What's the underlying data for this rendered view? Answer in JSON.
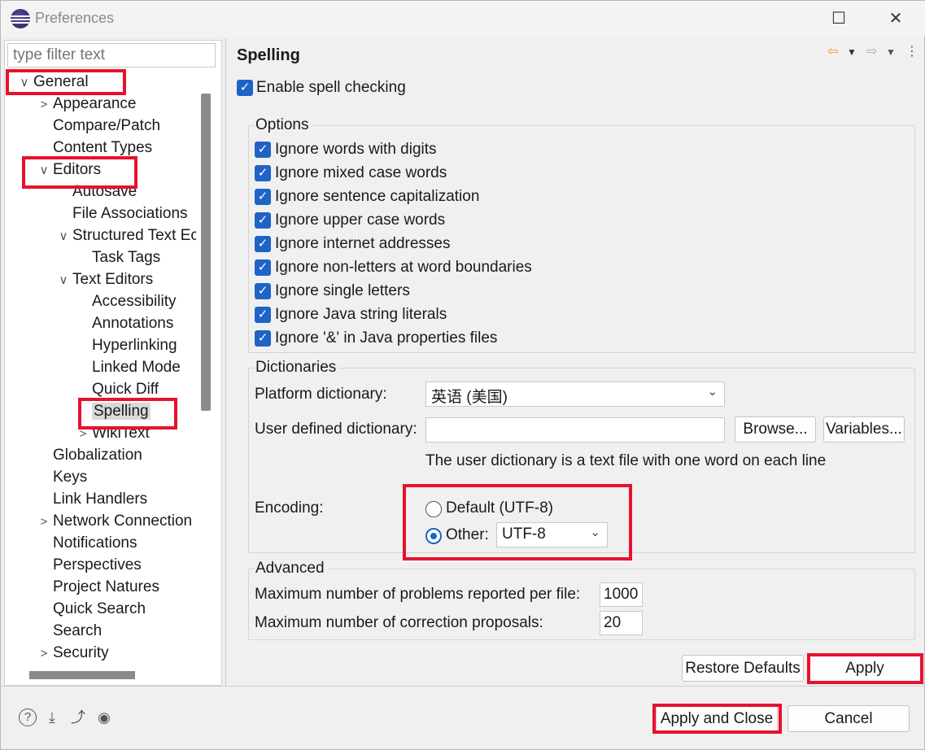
{
  "window": {
    "title": "Preferences",
    "maximize_icon": "☐",
    "close_icon": "✕"
  },
  "filter": {
    "placeholder": "type filter text"
  },
  "tree": [
    {
      "label": "General",
      "chev": "∨"
    },
    {
      "label": "Appearance",
      "chev": ">"
    },
    {
      "label": "Compare/Patch",
      "chev": ""
    },
    {
      "label": "Content Types",
      "chev": ""
    },
    {
      "label": "Editors",
      "chev": "∨"
    },
    {
      "label": "Autosave",
      "chev": ""
    },
    {
      "label": "File Associations",
      "chev": ""
    },
    {
      "label": "Structured Text Ec",
      "chev": "∨"
    },
    {
      "label": "Task Tags",
      "chev": ""
    },
    {
      "label": "Text Editors",
      "chev": "∨"
    },
    {
      "label": "Accessibility",
      "chev": ""
    },
    {
      "label": "Annotations",
      "chev": ""
    },
    {
      "label": "Hyperlinking",
      "chev": ""
    },
    {
      "label": "Linked Mode",
      "chev": ""
    },
    {
      "label": "Quick Diff",
      "chev": ""
    },
    {
      "label": "Spelling",
      "chev": ""
    },
    {
      "label": "WikiText",
      "chev": ">"
    },
    {
      "label": "Globalization",
      "chev": ""
    },
    {
      "label": "Keys",
      "chev": ""
    },
    {
      "label": "Link Handlers",
      "chev": ""
    },
    {
      "label": "Network Connection",
      "chev": ">"
    },
    {
      "label": "Notifications",
      "chev": ""
    },
    {
      "label": "Perspectives",
      "chev": ""
    },
    {
      "label": "Project Natures",
      "chev": ""
    },
    {
      "label": "Quick Search",
      "chev": ""
    },
    {
      "label": "Search",
      "chev": ""
    },
    {
      "label": "Security",
      "chev": ">"
    }
  ],
  "page": {
    "title": "Spelling",
    "enable_label": "Enable spell checking",
    "enable_checked": true,
    "options_title": "Options",
    "options": [
      "Ignore words with digits",
      "Ignore mixed case words",
      "Ignore sentence capitalization",
      "Ignore upper case words",
      "Ignore internet addresses",
      "Ignore non-letters at word boundaries",
      "Ignore single letters",
      "Ignore Java string literals",
      "Ignore '&' in Java properties files"
    ],
    "dict_title": "Dictionaries",
    "platform_dict_label": "Platform dictionary:",
    "platform_dict_value": "英语 (美国)",
    "user_dict_label": "User defined dictionary:",
    "user_dict_value": "",
    "browse_label": "Browse...",
    "variables_label": "Variables...",
    "user_dict_hint": "The user dictionary is a text file with one word on each line",
    "encoding_label": "Encoding:",
    "encoding_default_label": "Default (UTF-8)",
    "encoding_other_label": "Other:",
    "encoding_other_value": "UTF-8",
    "encoding_selected": "Other",
    "advanced_title": "Advanced",
    "max_problems_label": "Maximum number of problems reported per file:",
    "max_problems_value": "1000",
    "max_proposals_label": "Maximum number of correction proposals:",
    "max_proposals_value": "20",
    "restore_label": "Restore Defaults",
    "apply_label": "Apply"
  },
  "footer": {
    "apply_close_label": "Apply and Close",
    "cancel_label": "Cancel",
    "icons": [
      "help-icon",
      "import-icon",
      "export-icon",
      "record-icon"
    ]
  },
  "colors": {
    "accent": "#1f63c6",
    "highlight_box": "#e8112d"
  }
}
